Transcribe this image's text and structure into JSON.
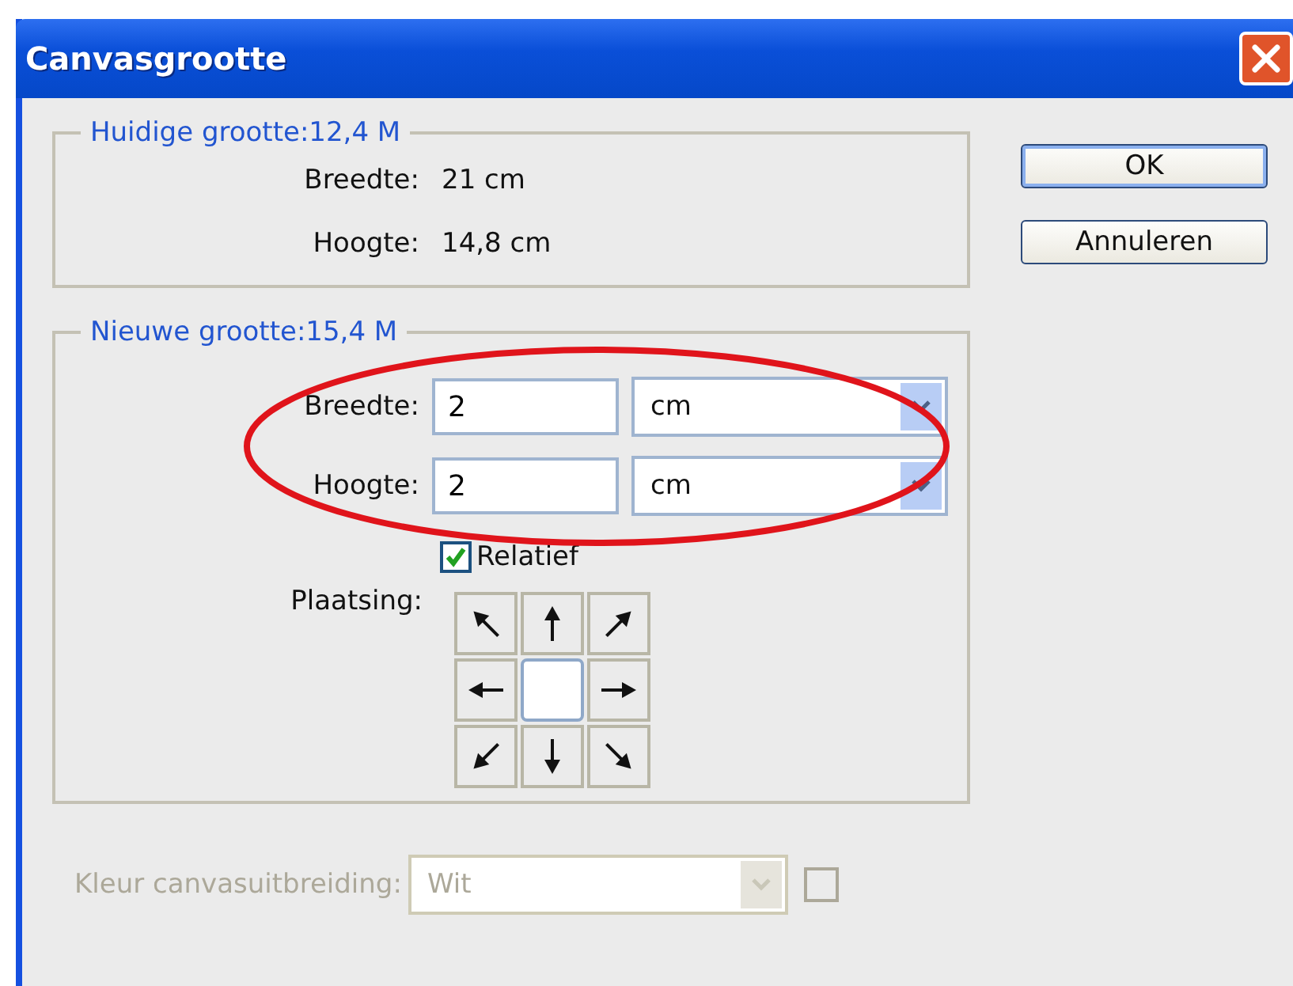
{
  "window": {
    "title": "Canvasgrootte"
  },
  "current_size": {
    "legend": "Huidige grootte:12,4 M",
    "rows": [
      {
        "label": "Breedte:",
        "value": "21 cm"
      },
      {
        "label": "Hoogte:",
        "value": "14,8 cm"
      }
    ]
  },
  "new_size": {
    "legend": "Nieuwe grootte:15,4 M",
    "fields": [
      {
        "label": "Breedte:",
        "value": "2",
        "unit": "cm"
      },
      {
        "label": "Hoogte:",
        "value": "2",
        "unit": "cm"
      }
    ],
    "relative": {
      "label": "Relatief",
      "checked": true
    },
    "anchor": {
      "label": "Plaatsing:",
      "cells": [
        {
          "selected": false
        },
        {
          "selected": false
        },
        {
          "selected": false
        },
        {
          "selected": false
        },
        {
          "selected": true
        },
        {
          "selected": false
        },
        {
          "selected": false
        },
        {
          "selected": false
        },
        {
          "selected": false
        }
      ]
    }
  },
  "extension_color": {
    "label": "Kleur canvasuitbreiding:",
    "value": "Wit",
    "disabled": true
  },
  "buttons": [
    "OK",
    "Annuleren"
  ]
}
